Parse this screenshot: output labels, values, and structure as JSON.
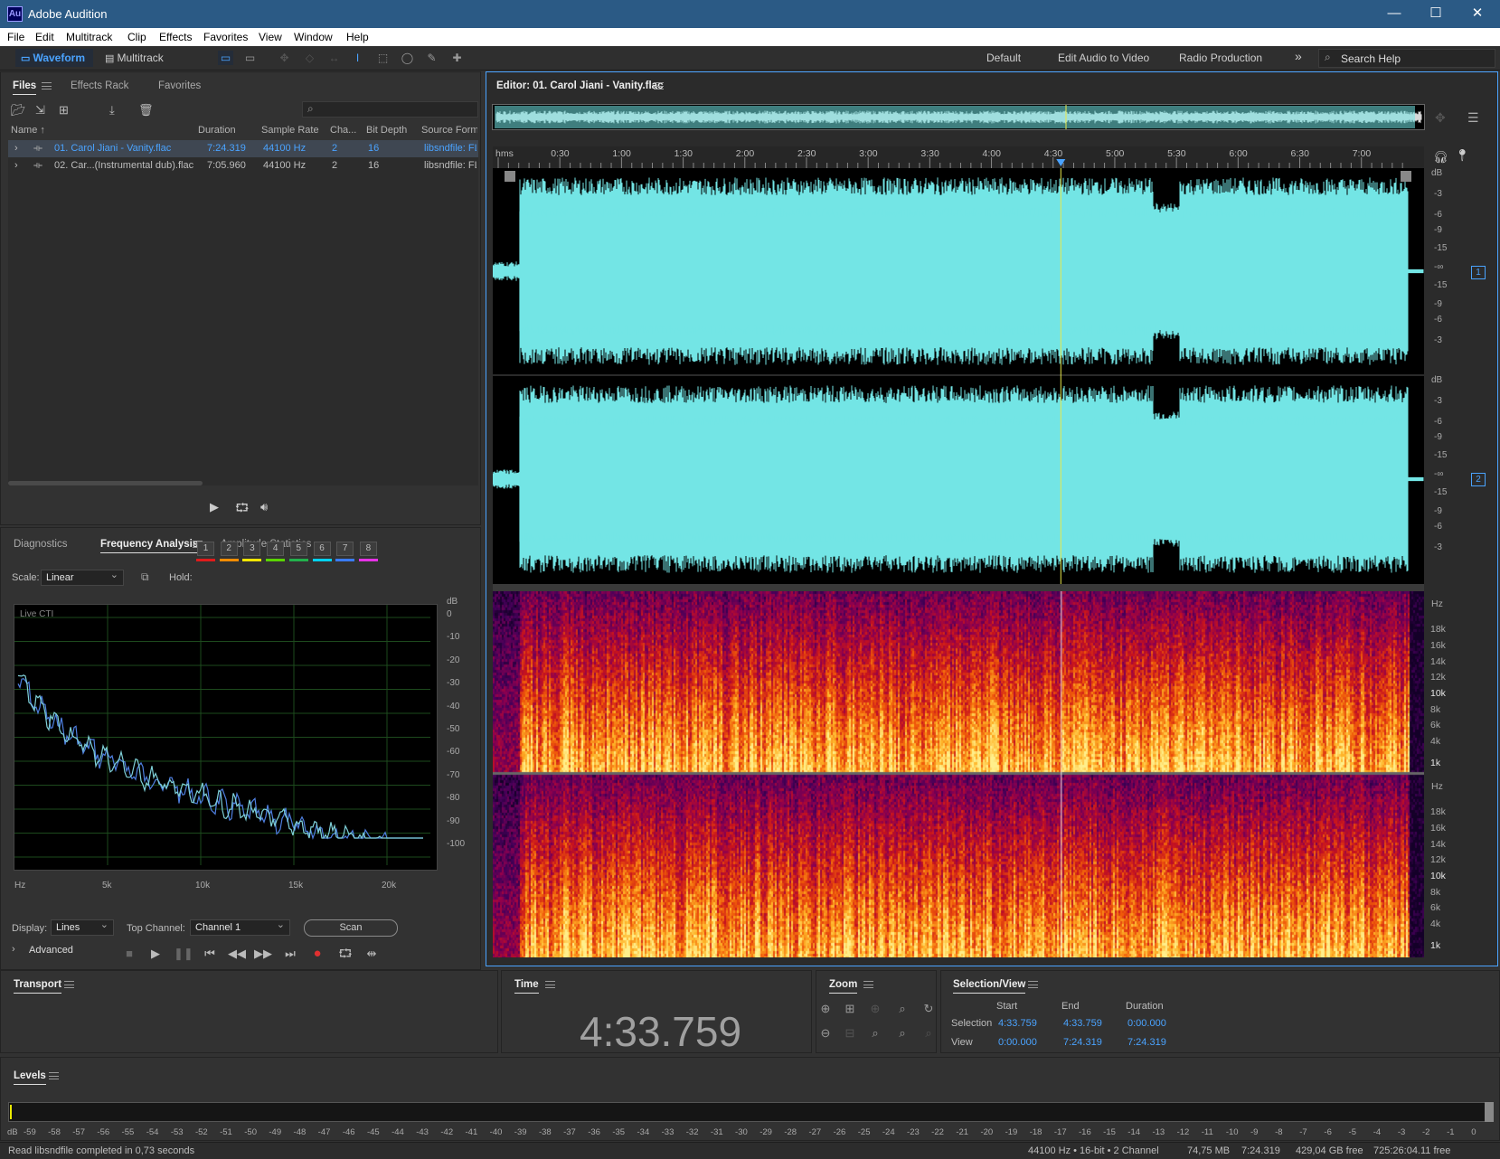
{
  "app": {
    "title": "Adobe Audition",
    "logo": "Au"
  },
  "menu": [
    "File",
    "Edit",
    "Multitrack",
    "Clip",
    "Effects",
    "Favorites",
    "View",
    "Window",
    "Help"
  ],
  "toolbar": {
    "waveform_label": "Waveform",
    "multitrack_label": "Multitrack",
    "workspaces": [
      "Default",
      "Edit Audio to Video",
      "Radio Production"
    ],
    "more": "»",
    "search_placeholder": "Search Help"
  },
  "files_panel": {
    "tabs": [
      "Files",
      "Effects Rack",
      "Favorites"
    ],
    "columns": [
      "Name ↑",
      "Duration",
      "Sample Rate",
      "Cha...",
      "Bit Depth",
      "Source Forma"
    ],
    "rows": [
      {
        "name": "01. Carol Jiani - Vanity.flac",
        "duration": "7:24.319",
        "rate": "44100 Hz",
        "channels": "2",
        "depth": "16",
        "source": "libsndfile: FL"
      },
      {
        "name": "02. Car...(Instrumental dub).flac",
        "duration": "7:05.960",
        "rate": "44100 Hz",
        "channels": "2",
        "depth": "16",
        "source": "libsndfile: FL"
      }
    ]
  },
  "analysis_panel": {
    "tabs": [
      "Diagnostics",
      "Frequency Analysis",
      "Amplitude Statistics"
    ],
    "scale_label": "Scale:",
    "scale_value": "Linear",
    "hold_label": "Hold:",
    "hold_buttons": [
      "1",
      "2",
      "3",
      "4",
      "5",
      "6",
      "7",
      "8"
    ],
    "hold_colors": [
      "#e01b1b",
      "#f28c00",
      "#f2e600",
      "#5ad400",
      "#22b14c",
      "#00d2f0",
      "#3a7cff",
      "#e632e6"
    ],
    "live_label": "Live CTI",
    "db_axis": [
      "dB",
      "0",
      "-10",
      "-20",
      "-30",
      "-40",
      "-50",
      "-60",
      "-70",
      "-80",
      "-90",
      "-100"
    ],
    "hz_axis": [
      "Hz",
      "5k",
      "10k",
      "15k",
      "20k"
    ],
    "display_label": "Display:",
    "display_value": "Lines",
    "top_channel_label": "Top Channel:",
    "top_channel_value": "Channel 1",
    "scan_label": "Scan",
    "advanced_label": "Advanced"
  },
  "editor": {
    "title": "Editor: 01. Carol Jiani - Vanity.flac",
    "ruler": [
      "hms",
      "0:30",
      "1:00",
      "1:30",
      "2:00",
      "2:30",
      "3:00",
      "3:30",
      "4:00",
      "4:30",
      "5:00",
      "5:30",
      "6:00",
      "6:30",
      "7:00"
    ],
    "db_scale": [
      "dB",
      "-3",
      "-6",
      "-9",
      "-15",
      "-∞",
      "-15",
      "-9",
      "-6",
      "-3"
    ],
    "channel_badges": [
      "1",
      "2"
    ],
    "hz_scale": [
      "Hz",
      "18k",
      "16k",
      "14k",
      "12k",
      "10k",
      "8k",
      "6k",
      "4k",
      "1k"
    ],
    "waveform_color": "#73e5e5",
    "playhead_color": "#e8e84a"
  },
  "transport": {
    "title": "Transport"
  },
  "time": {
    "title": "Time",
    "value": "4:33.759"
  },
  "zoom": {
    "title": "Zoom"
  },
  "selection": {
    "title": "Selection/View",
    "headers": [
      "Start",
      "End",
      "Duration"
    ],
    "rows": [
      {
        "label": "Selection",
        "start": "4:33.759",
        "end": "4:33.759",
        "duration": "0:00.000"
      },
      {
        "label": "View",
        "start": "0:00.000",
        "end": "7:24.319",
        "duration": "7:24.319"
      }
    ]
  },
  "levels": {
    "title": "Levels",
    "scale": [
      "dB",
      "-59",
      "-58",
      "-57",
      "-56",
      "-55",
      "-54",
      "-53",
      "-52",
      "-51",
      "-50",
      "-49",
      "-48",
      "-47",
      "-46",
      "-45",
      "-44",
      "-43",
      "-42",
      "-41",
      "-40",
      "-39",
      "-38",
      "-37",
      "-36",
      "-35",
      "-34",
      "-33",
      "-32",
      "-31",
      "-30",
      "-29",
      "-28",
      "-27",
      "-26",
      "-25",
      "-24",
      "-23",
      "-22",
      "-21",
      "-20",
      "-19",
      "-18",
      "-17",
      "-16",
      "-15",
      "-14",
      "-13",
      "-12",
      "-11",
      "-10",
      "-9",
      "-8",
      "-7",
      "-6",
      "-5",
      "-4",
      "-3",
      "-2",
      "-1",
      "0"
    ]
  },
  "status": {
    "message": "Read libsndfile completed in 0,73 seconds",
    "format": "44100 Hz • 16-bit • 2 Channel",
    "size": "74,75 MB",
    "duration": "7:24.319",
    "free": "429,04 GB free",
    "free_time": "725:26:04.11 free"
  }
}
